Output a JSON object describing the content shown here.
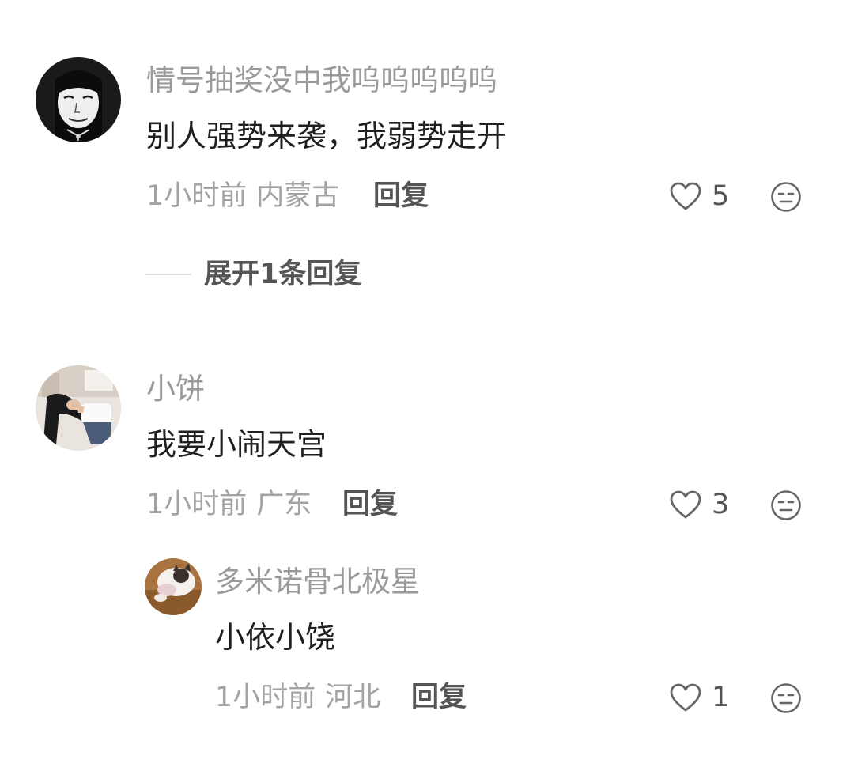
{
  "comments": [
    {
      "username": "情号抽奖没中我呜呜呜呜呜",
      "content": "别人强势来袭，我弱势走开",
      "time": "1小时前",
      "location": "内蒙古",
      "reply_label": "回复",
      "like_count": "5",
      "like_icon": "heart-outline-icon",
      "dislike_icon": "unamused-face-icon"
    },
    {
      "username": "小饼",
      "content": "我要小闹天宫",
      "time": "1小时前",
      "location": "广东",
      "reply_label": "回复",
      "like_count": "3",
      "like_icon": "heart-outline-icon",
      "dislike_icon": "unamused-face-icon",
      "replies": [
        {
          "username": "多米诺骨北极星",
          "content": "小依小饶",
          "time": "1小时前",
          "location": "河北",
          "reply_label": "回复",
          "like_count": "1",
          "like_icon": "heart-outline-icon",
          "dislike_icon": "unamused-face-icon"
        }
      ]
    }
  ],
  "expand_replies_label": "展开1条回复",
  "colors": {
    "username": "#9a9a9a",
    "content": "#1f1f1f",
    "meta": "#a3a3a3",
    "action": "#555555",
    "divider": "#dddddd"
  }
}
